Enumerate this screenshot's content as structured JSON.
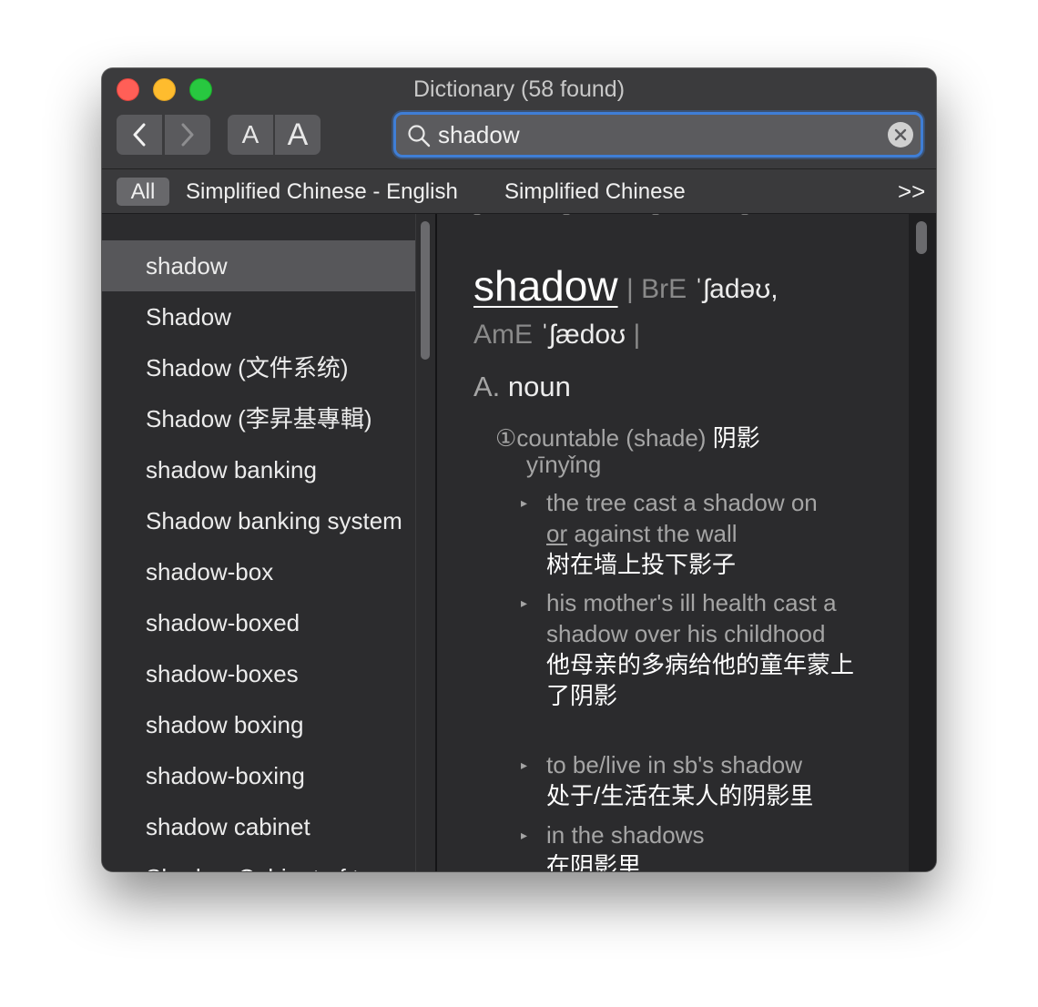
{
  "window": {
    "title": "Dictionary (58 found)"
  },
  "toolbar": {
    "back_icon": "chevron-left-icon",
    "forward_icon": "chevron-right-icon",
    "font_smaller_label": "A",
    "font_larger_label": "A"
  },
  "search": {
    "value": "shadow",
    "icon": "search-icon",
    "clear_icon": "clear-icon"
  },
  "scope_bar": {
    "items": [
      "All",
      "Simplified Chinese - English",
      "Simplified Chinese"
    ],
    "more_label": ">>",
    "selected": "All"
  },
  "sidebar": {
    "items": [
      "shadow",
      "Shadow",
      "Shadow (文件系统)",
      "Shadow (李昇基專輯)",
      "shadow banking",
      "Shadow banking system",
      "shadow-box",
      "shadow-boxed",
      "shadow-boxes",
      "shadow boxing",
      "shadow-boxing",
      "shadow cabinet",
      "Shadow Cabinet of t"
    ],
    "selected_index": 0
  },
  "entry": {
    "headword": "shadow",
    "pron_line1": {
      "sep_open": "|",
      "bre_label": "BrE",
      "bre_ipa": "ˈʃadəʊ,",
      "sep_close": ""
    },
    "pron_line2": {
      "ame_label": "AmE",
      "ame_ipa": "ˈʃædoʊ",
      "sep_close": "|"
    },
    "pos_letter": "A.",
    "pos": "noun",
    "sense": {
      "number": "①",
      "label": "countable (shade)",
      "zh": "阴影",
      "pinyin": "yīnyǐng"
    },
    "examples": [
      {
        "en_1": "the tree cast a shadow on",
        "en_u": "or",
        "en_2": " against the wall",
        "zh": "树在墙上投下影子"
      },
      {
        "en": "his mother's ill health cast a shadow over his childhood",
        "zh": "他母亲的多病给他的童年蒙上了阴影"
      },
      {
        "en": "to be/live in sb's shadow",
        "zh": "处于/生活在某人的阴影里"
      },
      {
        "en": "in the shadows",
        "zh": "在阴影里"
      }
    ]
  }
}
